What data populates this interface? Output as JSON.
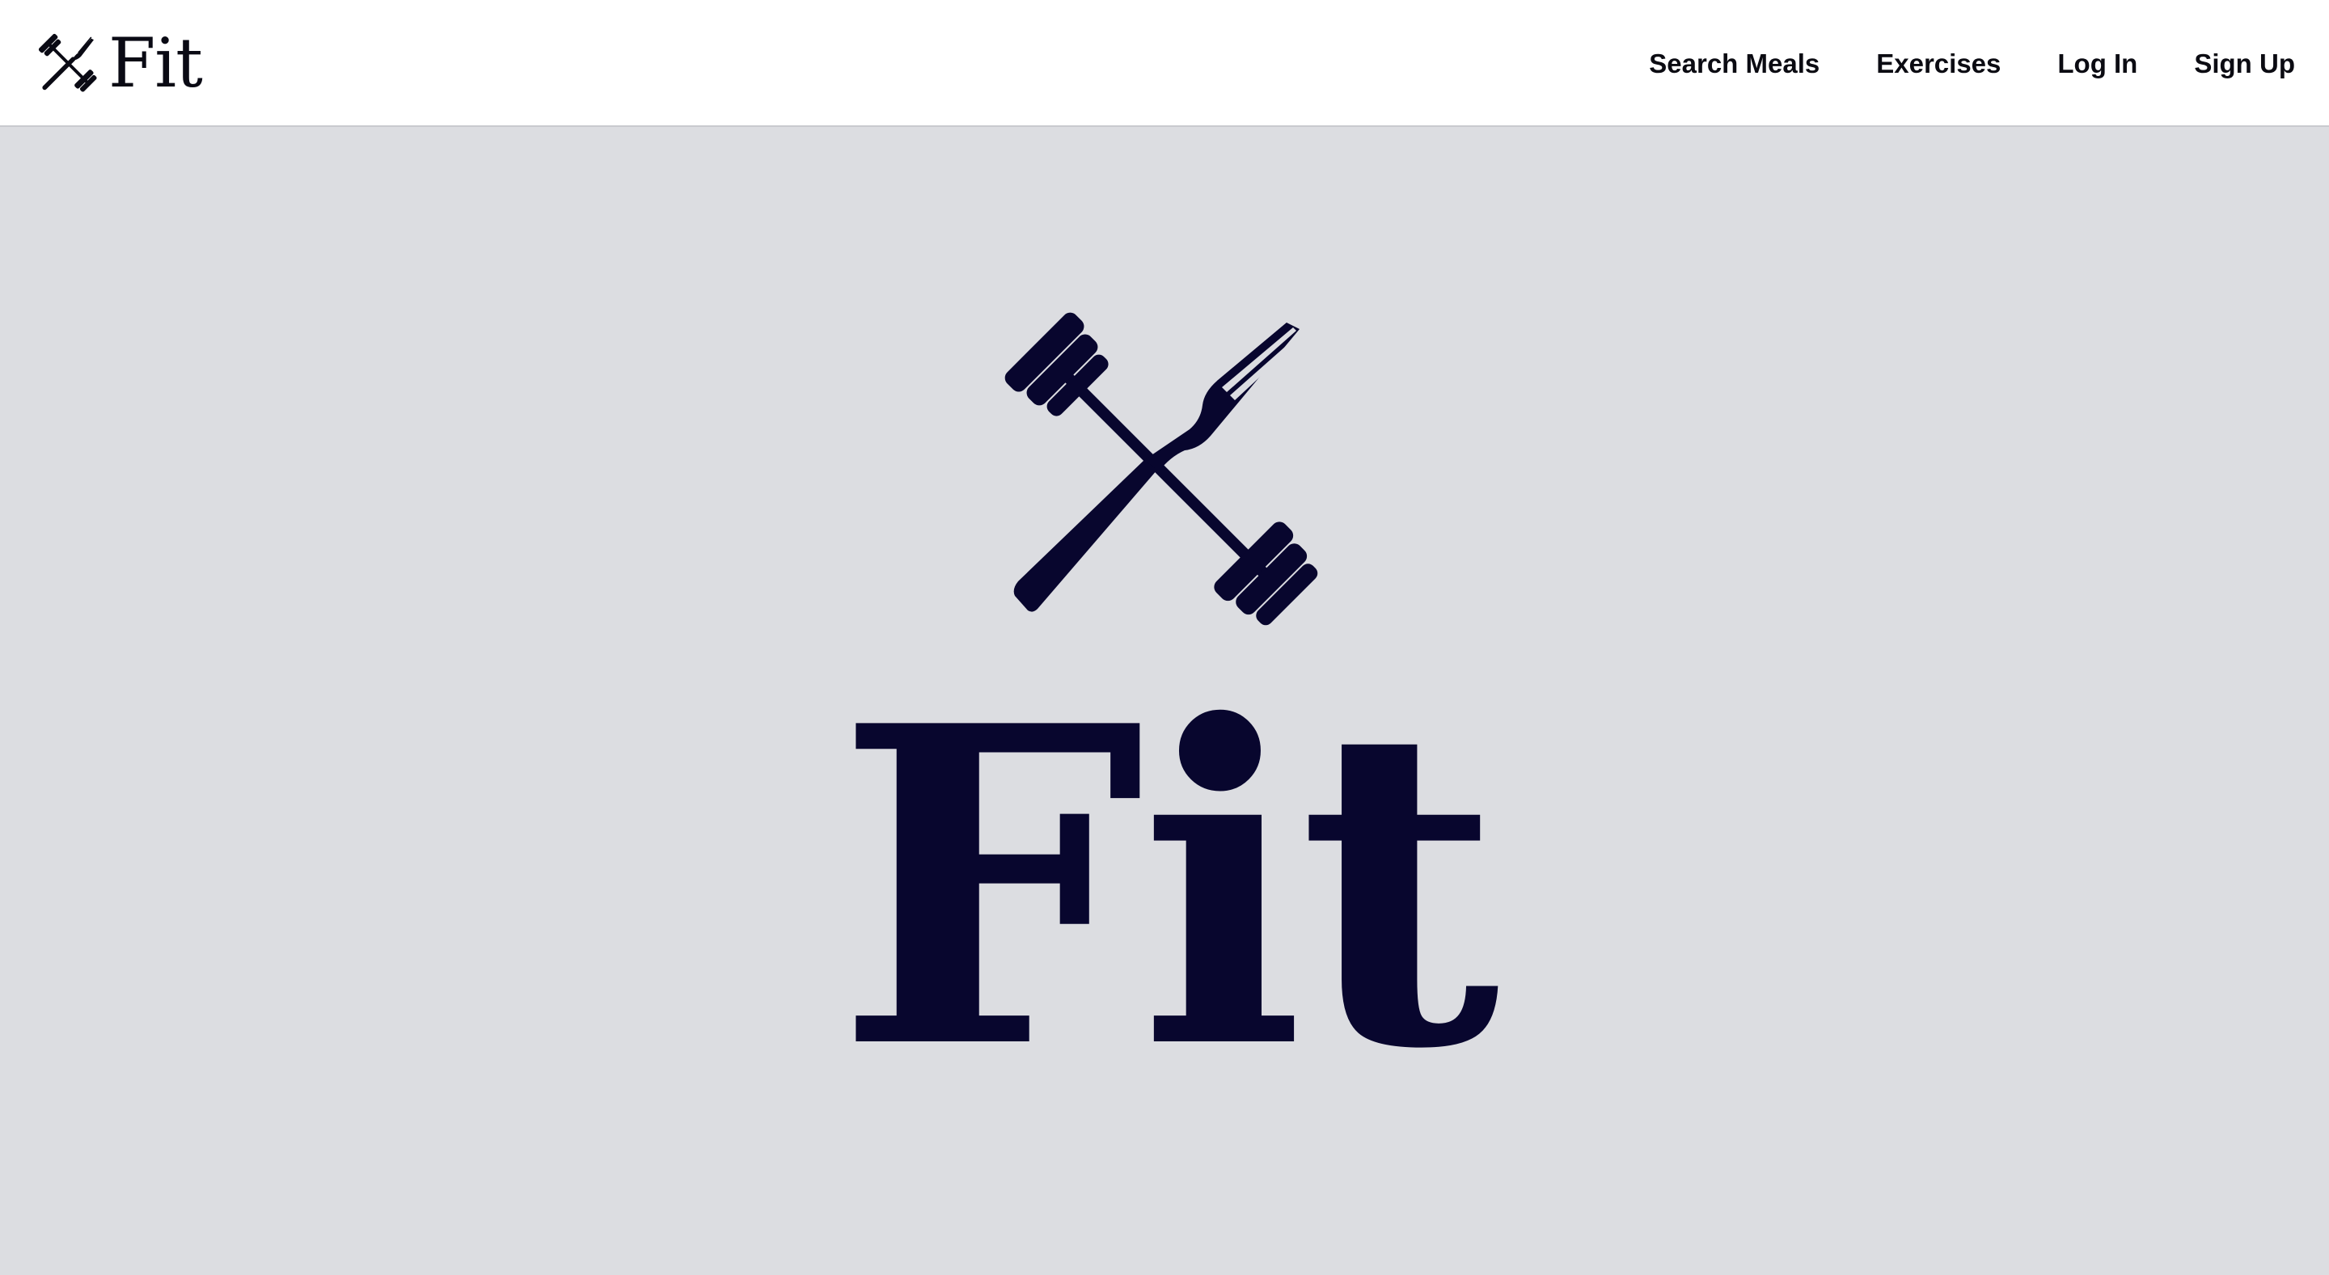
{
  "brand": {
    "name": "Fit",
    "icon": "dumbbell-fork-icon"
  },
  "nav": {
    "items": [
      {
        "label": "Search Meals"
      },
      {
        "label": "Exercises"
      },
      {
        "label": "Log In"
      },
      {
        "label": "Sign Up"
      }
    ]
  },
  "hero": {
    "title": "Fit",
    "icon": "dumbbell-fork-icon"
  },
  "colors": {
    "nav_background": "#ffffff",
    "hero_background": "#dcdde1",
    "logo_navy": "#08062e",
    "text_dark": "#0b0b12"
  }
}
